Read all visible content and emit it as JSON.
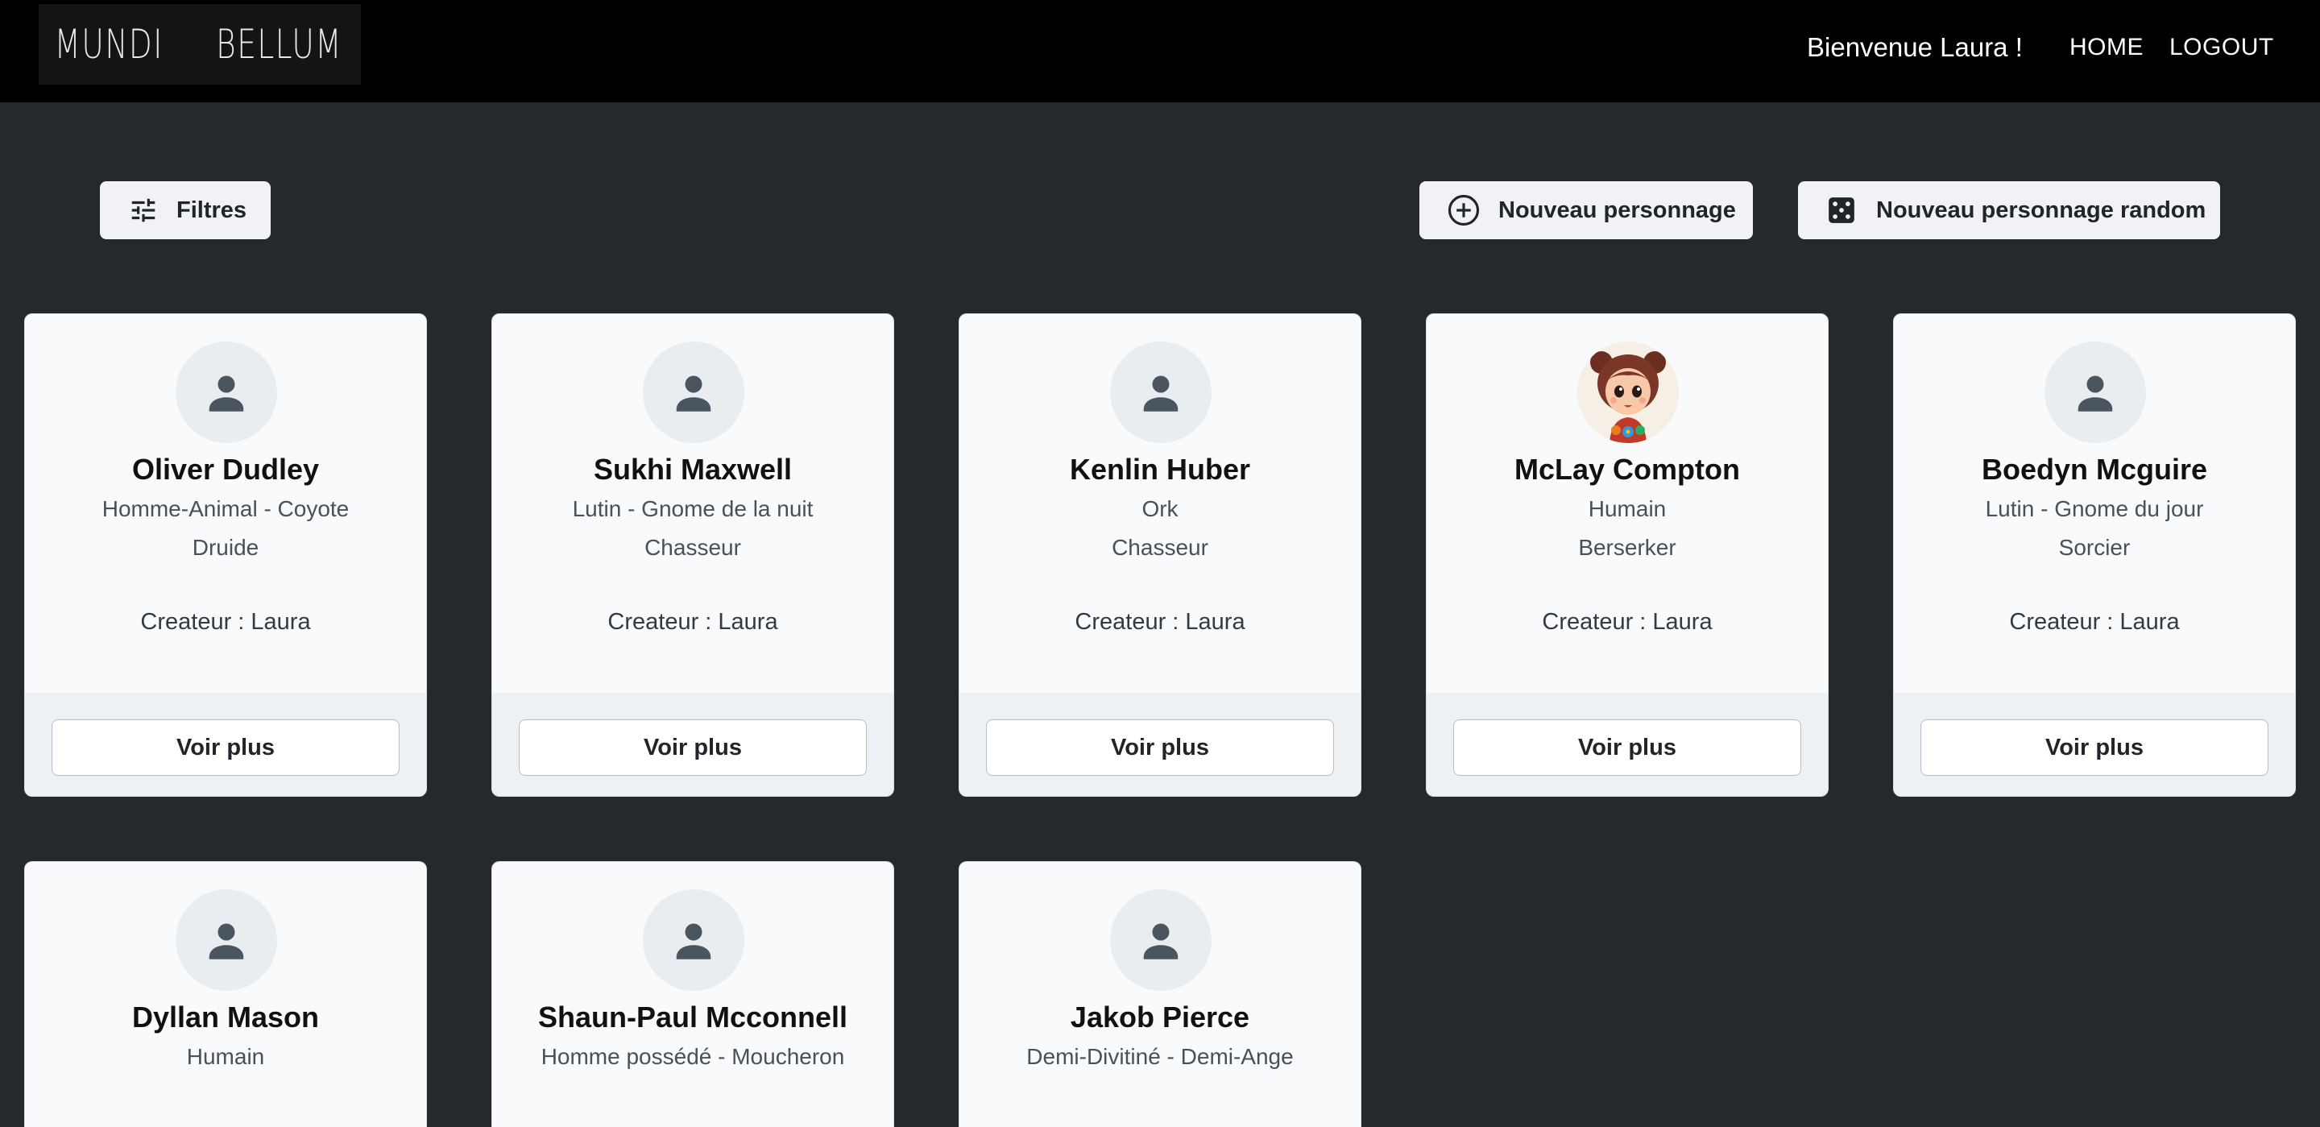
{
  "navbar": {
    "logo_left": "MUNDI",
    "logo_right": "BELLUM",
    "welcome": "Bienvenue Laura !",
    "home": "HOME",
    "logout": "LOGOUT"
  },
  "toolbar": {
    "filters": "Filtres",
    "new_character": "Nouveau personnage",
    "new_random_character": "Nouveau personnage random"
  },
  "cards": [
    {
      "name": "Oliver Dudley",
      "race": "Homme-Animal - Coyote",
      "class": "Druide",
      "creator": "Createur : Laura",
      "button": "Voir plus",
      "avatar": "person-icon"
    },
    {
      "name": "Sukhi Maxwell",
      "race": "Lutin - Gnome de la nuit",
      "class": "Chasseur",
      "creator": "Createur : Laura",
      "button": "Voir plus",
      "avatar": "person-icon"
    },
    {
      "name": "Kenlin Huber",
      "race": "Ork",
      "class": "Chasseur",
      "creator": "Createur : Laura",
      "button": "Voir plus",
      "avatar": "person-icon"
    },
    {
      "name": "McLay Compton",
      "race": "Humain",
      "class": "Berserker",
      "creator": "Createur : Laura",
      "button": "Voir plus",
      "avatar": "character-portrait"
    },
    {
      "name": "Boedyn Mcguire",
      "race": "Lutin - Gnome du jour",
      "class": "Sorcier",
      "creator": "Createur : Laura",
      "button": "Voir plus",
      "avatar": "person-icon"
    },
    {
      "name": "Dyllan Mason",
      "race": "Humain",
      "avatar": "person-icon"
    },
    {
      "name": "Shaun-Paul Mcconnell",
      "race": "Homme possédé - Moucheron",
      "avatar": "person-icon"
    },
    {
      "name": "Jakob Pierce",
      "race": "Demi-Divitiné - Demi-Ange",
      "avatar": "person-icon"
    }
  ],
  "colors": {
    "page_bg": "#25282d",
    "navbar_bg": "#000000",
    "card_bg": "#f8fafc",
    "icon_gray": "#4a5560"
  }
}
